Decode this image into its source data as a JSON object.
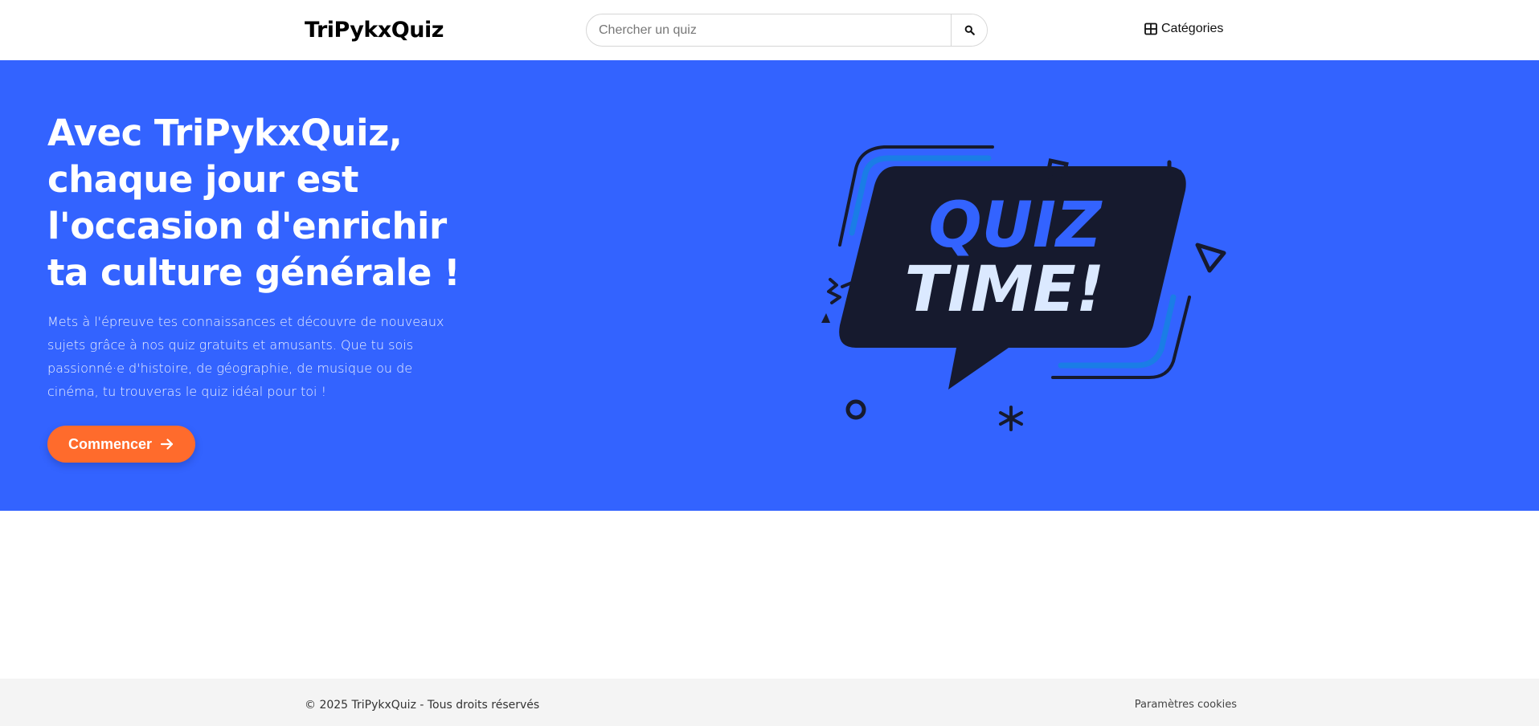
{
  "header": {
    "logo": "TriPykxQuiz",
    "search_placeholder": "Chercher un quiz",
    "categories_label": "Catégories"
  },
  "hero": {
    "title": "Avec TriPykxQuiz, chaque jour est l'occasion d'enrichir ta culture générale !",
    "text": "Mets à l'épreuve tes connaissances et découvre de nouveaux sujets grâce à nos quiz gratuits et amusants. Que tu sois passionné·e d'histoire, de géographie, de musique ou de cinéma, tu trouveras le quiz idéal pour toi !",
    "cta_label": "Commencer",
    "illustration": {
      "line1": "QUIZ",
      "line2": "TIME!"
    }
  },
  "footer": {
    "copyright": "© 2025 TriPykxQuiz - Tous droits réservés",
    "cookies_label": "Paramètres cookies"
  },
  "colors": {
    "hero_bg": "#3363ff",
    "cta_bg": "#ff6b2c",
    "bubble": "#161a2e",
    "quiz_text": "#3363ff",
    "time_text": "#dbe9ff"
  }
}
